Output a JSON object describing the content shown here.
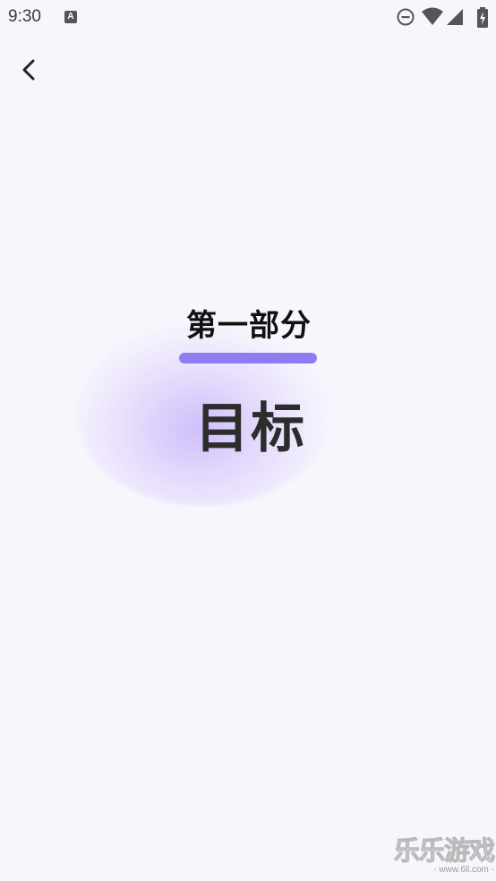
{
  "status_bar": {
    "time": "9:30",
    "notification_icon": "A"
  },
  "nav": {
    "back_icon": "chevron-left"
  },
  "content": {
    "section_title": "第一部分",
    "main_title": "目标",
    "accent_color": "#8e7cf3"
  },
  "watermark": {
    "main_text": "乐乐游戏",
    "sub_text": "- www.6ll.com -"
  }
}
